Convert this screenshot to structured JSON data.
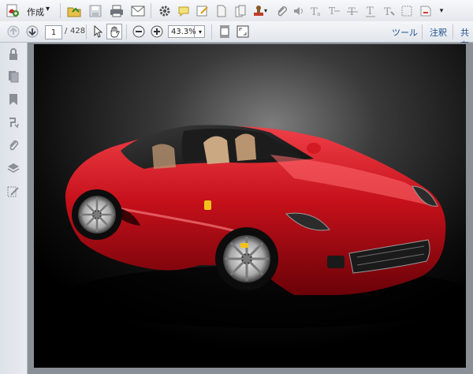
{
  "toolbar": {
    "create_label": "作成",
    "create_dropdown": "▾"
  },
  "nav": {
    "current_page": "1",
    "page_separator": "/",
    "total_pages": "428",
    "zoom_value": "43.3%"
  },
  "right_links": {
    "tools": "ツール",
    "comment": "注釈",
    "share": "共有"
  },
  "colors": {
    "accent_link": "#1f4f8c",
    "car_red": "#c5101a"
  }
}
